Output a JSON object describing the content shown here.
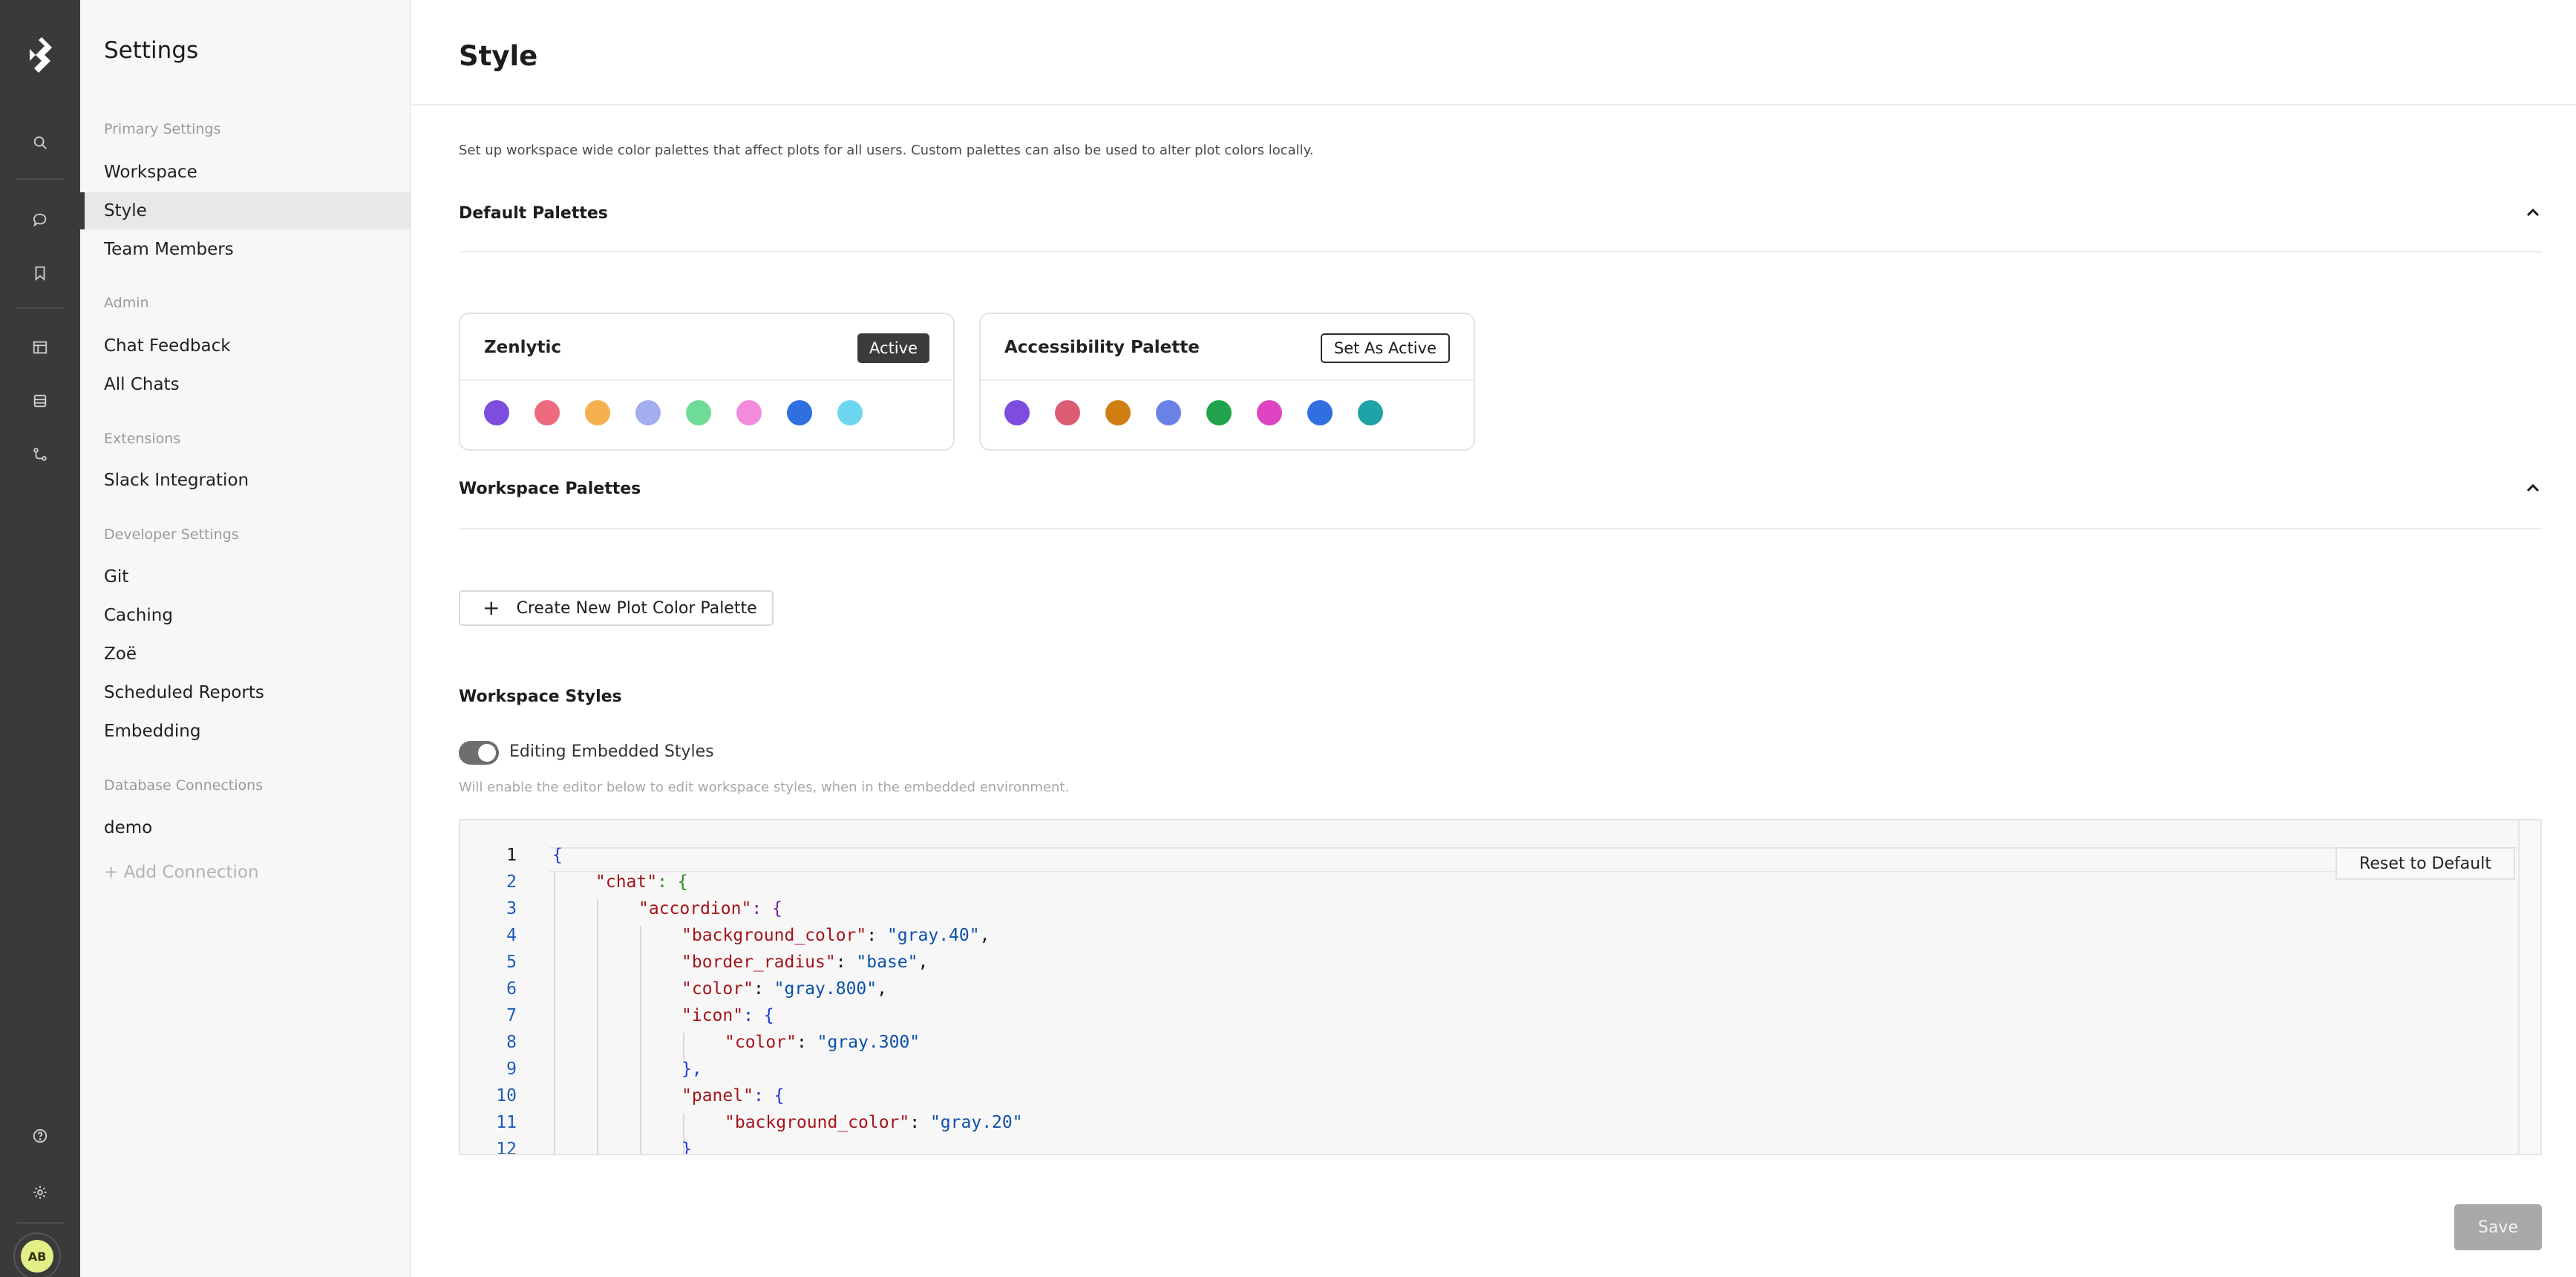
{
  "rail": {
    "logo": "zenlytic-logo",
    "icons": [
      "search-icon",
      "chat-icon",
      "bookmark-icon",
      "table-icon",
      "database-icon",
      "git-branch-icon",
      "help-icon",
      "gear-icon"
    ],
    "avatar_initials": "AB"
  },
  "sidebar": {
    "title": "Settings",
    "sections": [
      {
        "label": "Primary Settings",
        "items": [
          "Workspace",
          "Style",
          "Team Members"
        ]
      },
      {
        "label": "Admin",
        "items": [
          "Chat Feedback",
          "All Chats"
        ]
      },
      {
        "label": "Extensions",
        "items": [
          "Slack Integration"
        ]
      },
      {
        "label": "Developer Settings",
        "items": [
          "Git",
          "Caching",
          "Zoë",
          "Scheduled Reports",
          "Embedding"
        ]
      },
      {
        "label": "Database Connections",
        "items": [
          "demo",
          "+ Add Connection"
        ]
      }
    ],
    "active_item": "Style"
  },
  "main": {
    "title": "Style",
    "intro": "Set up workspace wide color palettes that affect plots for all users. Custom palettes can also be used to alter plot colors locally.",
    "default_palettes": {
      "heading": "Default Palettes",
      "palettes": [
        {
          "name": "Zenlytic",
          "badge": "Active",
          "colors": [
            "#7c4ddf",
            "#ec6b7f",
            "#f4b04f",
            "#a3aef0",
            "#6fdb98",
            "#f28bdc",
            "#2f6fe0",
            "#6dd6ef"
          ]
        },
        {
          "name": "Accessibility Palette",
          "badge": "Set As Active",
          "colors": [
            "#7c4ddf",
            "#dc5d72",
            "#cf7f12",
            "#6a82e6",
            "#21a34b",
            "#de43c2",
            "#2f6fe0",
            "#1ea3a6"
          ]
        }
      ]
    },
    "workspace_palettes": {
      "heading": "Workspace Palettes",
      "create_button": "Create New Plot Color Palette"
    },
    "workspace_styles": {
      "heading": "Workspace Styles",
      "toggle_label": "Editing Embedded Styles",
      "toggle_on": true,
      "help_text": "Will enable the editor below to edit workspace styles, when in the embedded environment.",
      "reset_button": "Reset to Default",
      "current_line": 1,
      "line_numbers": [
        "1",
        "2",
        "3",
        "4",
        "5",
        "6",
        "7",
        "8",
        "9",
        "10",
        "11",
        "12"
      ],
      "code": {
        "l1": "{",
        "l2_key": "\"chat\"",
        "l2_rest": ": {",
        "l3_key": "\"accordion\"",
        "l3_rest": ": {",
        "l4_key": "\"background_color\"",
        "l4_val": "\"gray.40\"",
        "l5_key": "\"border_radius\"",
        "l5_val": "\"base\"",
        "l6_key": "\"color\"",
        "l6_val": "\"gray.800\"",
        "l7_key": "\"icon\"",
        "l7_rest": ": {",
        "l8_key": "\"color\"",
        "l8_val": "\"gray.300\"",
        "l9": "},",
        "l10_key": "\"panel\"",
        "l10_rest": ": {",
        "l11_key": "\"background_color\"",
        "l11_val": "\"gray.20\"",
        "l12": "}"
      }
    },
    "save_button": "Save"
  }
}
